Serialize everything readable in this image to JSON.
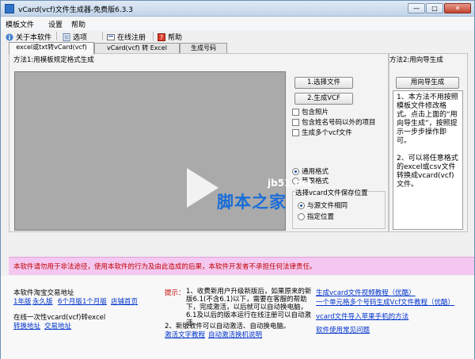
{
  "window": {
    "title": "vCard(vcf)文件生成器-免费版6.3.3",
    "controls": [
      "—",
      "□",
      "✕"
    ]
  },
  "menu": [
    "模板文件",
    "设置",
    "帮助"
  ],
  "toolbar": {
    "about": "关于本软件",
    "options": "选项",
    "register": "在线注册",
    "help": "帮助"
  },
  "tabs": [
    "excel或txt转vCard(vcf)",
    "vCard(vcf) 转 Excel",
    "生成号码"
  ],
  "method1": {
    "title": "方法1:用模板规定格式生成",
    "btn_select_file": "1.选择文件",
    "btn_generate": "2.生成VCF",
    "checkboxes": [
      "包含照片",
      "包含姓名号码以外的项目",
      "生成多个vcf文件"
    ],
    "format_options": [
      "通用格式",
      "苹果格式"
    ],
    "save_group_title": "选择vcard文件保存位置",
    "save_options": [
      "与源文件相同",
      "指定位置"
    ]
  },
  "method2": {
    "title": "方法2:用向导生成",
    "btn_wizard": "用向导生成",
    "description": "1、本方法不用按照模板文件修改格式。点击上面的“用向导生成”，按照提示一步步操作即可。\n\n2、可以将任意格式的excel或csv文件转换成vcard(vcf)文件。"
  },
  "watermark": {
    "small": "jb51.net",
    "large": "脚本之家"
  },
  "warning": "本软件请勿用于非法途径，使用本软件的行为及由此造成的后果，本软件开发者不承担任何法律责任。",
  "bottom": {
    "shop_label": "本软件淘宝交易地址",
    "shop_links": [
      "1年版",
      "永久版",
      "6个月版",
      "1个月版",
      "店铺首页"
    ],
    "excel_label": "在线一次性vcard(vcf)转excel",
    "excel_links": [
      "转换地址",
      "交易地址"
    ],
    "tip_label": "提示：",
    "tip_text": "1、收费新用户升级新版后，如果原来的新版6.1(不含6.1)以下，需要在客服的帮助下，完成激活，以后就可以自动换电脑，6.1及以后的版本运行在线注册可以自动激活。",
    "tip_line2": "2、新版软件可以自动激活、自动换电脑。",
    "tip_links": [
      "激活文字教程",
      "自动激活换机说明"
    ],
    "right_links": [
      "生成vcard文件视频教程（优酷）",
      "一个单元格多个号码生成Vcf文件教程（优酷）",
      "vcard文件导入苹果手机的方法",
      "软件使用常见问题"
    ]
  },
  "colors": {
    "warning_bg": "#f4c8f0",
    "warning_text": "#c00000",
    "link": "#0033cc",
    "preview_gray": "#aaaaaa"
  }
}
